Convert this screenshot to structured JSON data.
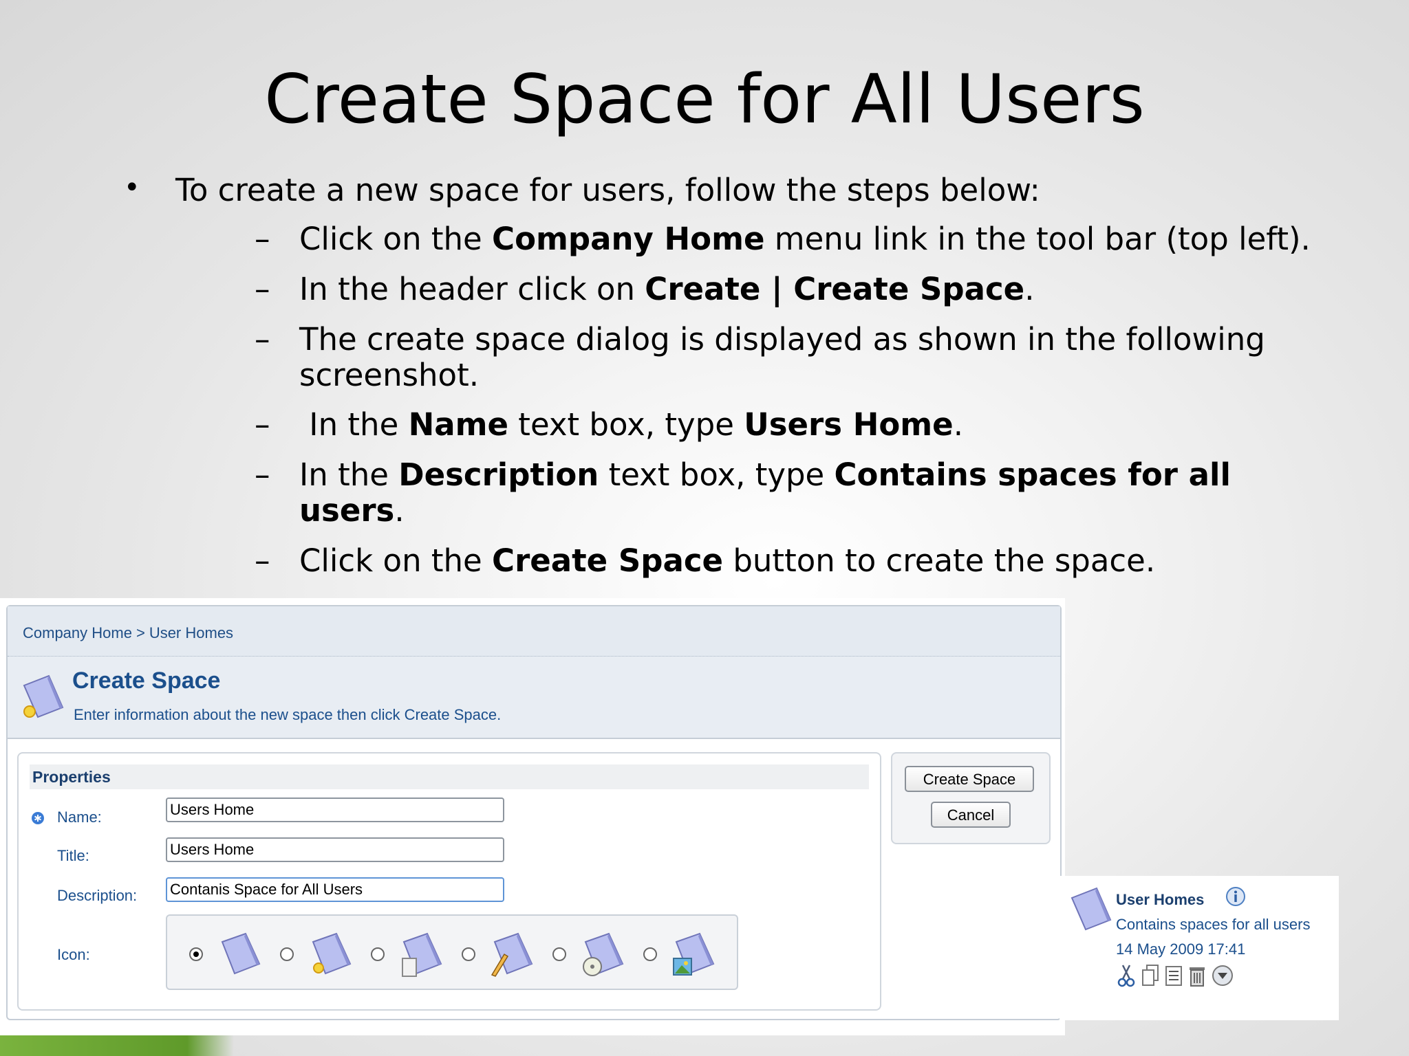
{
  "slide": {
    "title": "Create Space for All Users",
    "intro": "To create a new space for users, follow the steps below:",
    "bullet_symbol": "•",
    "dash_symbol": "–",
    "steps": [
      {
        "pre": "Click on the ",
        "b1": "Company Home",
        "mid": " menu link in the tool bar (top left).",
        "b2": "",
        "post": ""
      },
      {
        "pre": "In the header click on ",
        "b1": "Create | Create Space",
        "mid": ".",
        "b2": "",
        "post": ""
      },
      {
        "pre": "The create space dialog is displayed as shown in the following screenshot.",
        "b1": "",
        "mid": "",
        "b2": "",
        "post": ""
      },
      {
        "pre": " In the ",
        "b1": "Name",
        "mid": " text box, type ",
        "b2": "Users Home",
        "post": "."
      },
      {
        "pre": "In the ",
        "b1": "Description",
        "mid": " text box, type ",
        "b2": "Contains spaces for all users",
        "post": "."
      },
      {
        "pre": "Click on the ",
        "b1": "Create Space",
        "mid": " button to create the space.",
        "b2": "",
        "post": ""
      }
    ]
  },
  "dialog": {
    "breadcrumb": {
      "item1": "Company Home",
      "separator": ">",
      "item2": "User Homes"
    },
    "title": "Create Space",
    "subtitle": "Enter information about the new space then click Create Space.",
    "properties_heading": "Properties",
    "fields": {
      "name_label": "Name:",
      "name_value": "Users Home",
      "title_label": "Title:",
      "title_value": "Users Home",
      "description_label": "Description:",
      "description_value": "Contanis Space for All Users",
      "icon_label": "Icon:"
    },
    "icon_options": [
      "space-icon",
      "space-new-icon",
      "space-document-icon",
      "space-edit-icon",
      "space-cd-icon",
      "space-image-icon"
    ],
    "selected_icon_index": 0,
    "create_button": "Create Space",
    "cancel_button": "Cancel"
  },
  "card": {
    "title": "User Homes",
    "description": "Contains spaces for all users",
    "date": "14 May 2009 17:41",
    "actions": [
      "cut-icon",
      "copy-icon",
      "details-icon",
      "delete-icon",
      "more-icon"
    ]
  },
  "colors": {
    "accent_blue": "#1b4f8c",
    "brand_green": "#6fa836"
  }
}
